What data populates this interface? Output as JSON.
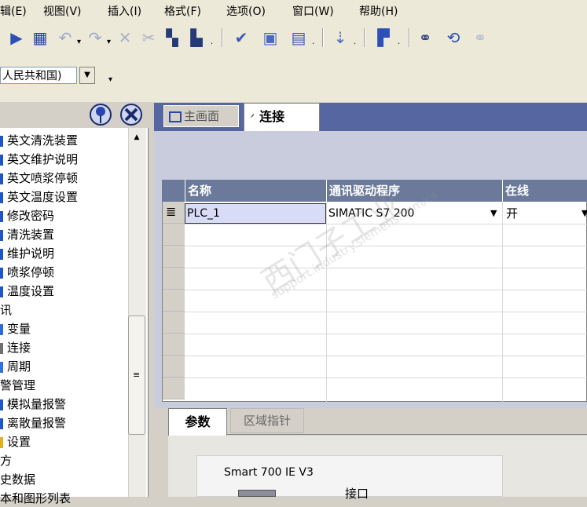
{
  "menu": {
    "items": [
      "辑(E)",
      "视图(V)",
      "插入(I)",
      "格式(F)",
      "选项(O)",
      "窗口(W)",
      "帮助(H)"
    ]
  },
  "toolbar": {
    "icons": [
      "open-folder-icon",
      "save-icon",
      "undo-icon",
      "redo-icon",
      "delete-icon",
      "cut-icon",
      "copy-icon",
      "paste-icon",
      "check-icon",
      "compile-icon",
      "transfer-icon",
      "download-icon",
      "library-icon",
      "find-icon",
      "replace-icon"
    ]
  },
  "language_selector": {
    "value": "人民共和国)"
  },
  "tree": {
    "items": [
      {
        "label": "英文清洗装置",
        "kind": "screen"
      },
      {
        "label": "英文维护说明",
        "kind": "screen"
      },
      {
        "label": "英文喷浆停顿",
        "kind": "screen"
      },
      {
        "label": "英文温度设置",
        "kind": "screen"
      },
      {
        "label": "修改密码",
        "kind": "screen"
      },
      {
        "label": "清洗装置",
        "kind": "screen"
      },
      {
        "label": "维护说明",
        "kind": "screen"
      },
      {
        "label": "喷浆停顿",
        "kind": "screen"
      },
      {
        "label": "温度设置",
        "kind": "screen"
      },
      {
        "label": "讯",
        "kind": "folder"
      },
      {
        "label": "变量",
        "kind": "tags"
      },
      {
        "label": "连接",
        "kind": "connections"
      },
      {
        "label": "周期",
        "kind": "cycles"
      },
      {
        "label": "警管理",
        "kind": "folder"
      },
      {
        "label": "模拟量报警",
        "kind": "alarm"
      },
      {
        "label": "离散量报警",
        "kind": "alarm"
      },
      {
        "label": "设置",
        "kind": "settings"
      },
      {
        "label": "方",
        "kind": "folder"
      },
      {
        "label": "史数据",
        "kind": "folder"
      },
      {
        "label": "本和图形列表",
        "kind": "folder"
      }
    ]
  },
  "editor_tabs": {
    "main_screen": "主画面",
    "connections": "连接"
  },
  "grid": {
    "columns": [
      "名称",
      "通讯驱动程序",
      "在线"
    ],
    "rows": [
      {
        "name": "PLC_1",
        "driver": "SIMATIC S7 200",
        "online": "开"
      }
    ]
  },
  "properties": {
    "tabs": [
      "参数",
      "区域指针"
    ],
    "device": "Smart 700 IE V3",
    "interface_label": "接口"
  },
  "watermark": {
    "line1": "西门子工业",
    "line2": "support.industry.siemens.com/cs"
  },
  "colors": {
    "tab_strip": "#5566a0",
    "grid_header": "#6b7a9a",
    "selected_cell": "#d8dcf6"
  }
}
